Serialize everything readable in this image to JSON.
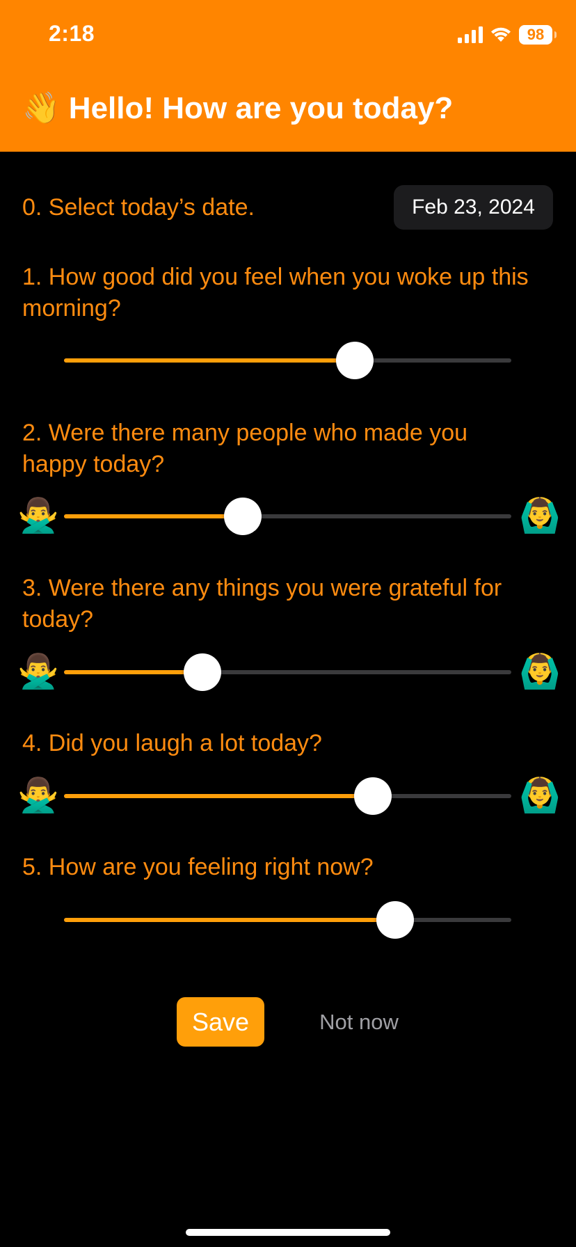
{
  "status_bar": {
    "time": "2:18",
    "battery": "98",
    "icons": [
      "cellular-signal-icon",
      "wifi-icon",
      "battery-icon"
    ]
  },
  "header": {
    "emoji": "👋",
    "title": "Hello! How are you today?",
    "background": "#FF8500"
  },
  "date_row": {
    "label": "0. Select today’s date.",
    "value": "Feb 23, 2024"
  },
  "questions": [
    {
      "text": "1. How good did you feel when you woke up this morning?",
      "left_emoji": "😡",
      "right_emoji": "😄",
      "value": 0.65
    },
    {
      "text": "2. Were there many people who made you happy today?",
      "left_emoji": "🙅‍♂️",
      "right_emoji": "🙆‍♂️",
      "value": 0.4
    },
    {
      "text": "3. Were there any things you were grateful for today?",
      "left_emoji": "🙅‍♂️",
      "right_emoji": "🙆‍♂️",
      "value": 0.31
    },
    {
      "text": "4. Did you laugh a lot today?",
      "left_emoji": "🙅‍♂️",
      "right_emoji": "🙆‍♂️",
      "value": 0.69
    },
    {
      "text": "5. How are you feeling right now?",
      "left_emoji": "😡",
      "right_emoji": "😄",
      "value": 0.74
    }
  ],
  "actions": {
    "save": "Save",
    "not_now": "Not now"
  },
  "colors": {
    "accent": "#FF9F0A",
    "question_text": "#FF8C10",
    "track": "#3A3A3C",
    "background": "#000000"
  }
}
